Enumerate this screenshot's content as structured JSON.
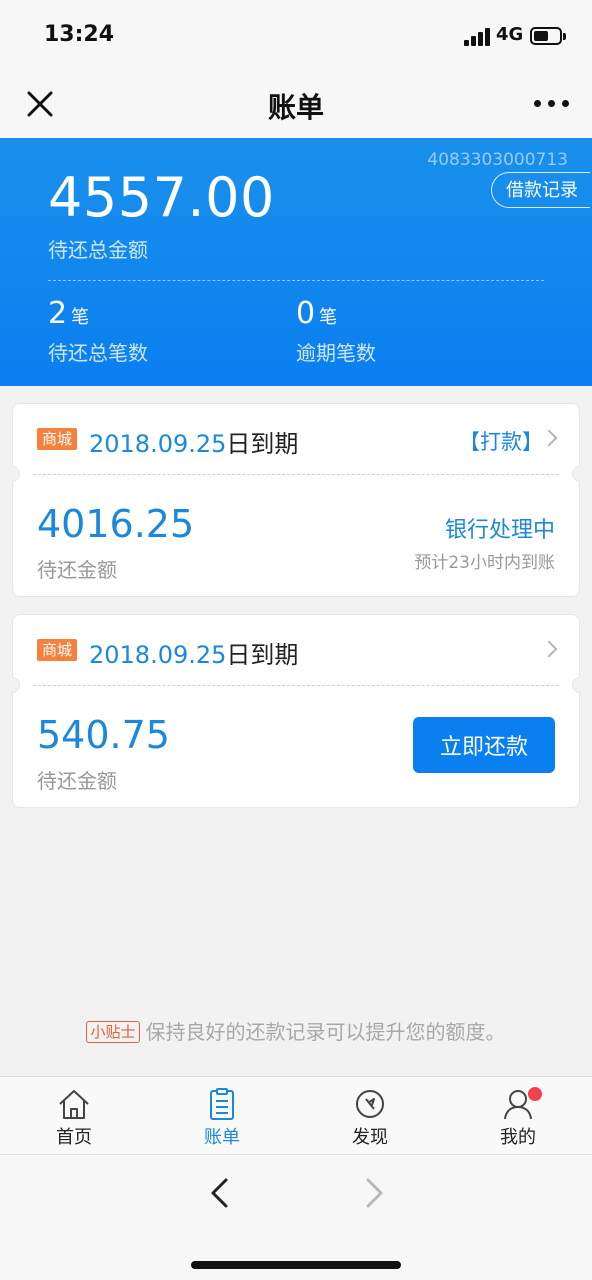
{
  "status_bar": {
    "time": "13:24",
    "network": "4G"
  },
  "nav": {
    "title": "账单"
  },
  "summary": {
    "account_no": "4083303000713",
    "loan_record_label": "借款记录",
    "total_amount": "4557.00",
    "total_label": "待还总金额",
    "pending_count": "2",
    "pending_unit": "笔",
    "pending_label": "待还总笔数",
    "overdue_count": "0",
    "overdue_unit": "笔",
    "overdue_label": "逾期笔数"
  },
  "bills": [
    {
      "tag": "商城",
      "due_date": "2018.09.25",
      "due_suffix": "日到期",
      "action": "【打款】",
      "amount": "4016.25",
      "amount_label": "待还金额",
      "status": "银行处理中",
      "status_note": "预计23小时内到账"
    },
    {
      "tag": "商城",
      "due_date": "2018.09.25",
      "due_suffix": "日到期",
      "amount": "540.75",
      "amount_label": "待还金额",
      "repay_button": "立即还款"
    }
  ],
  "tip": {
    "badge": "小贴士",
    "text": "保持良好的还款记录可以提升您的额度。"
  },
  "tabs": [
    {
      "label": "首页",
      "icon": "home-icon"
    },
    {
      "label": "账单",
      "icon": "bill-icon"
    },
    {
      "label": "发现",
      "icon": "compass-icon"
    },
    {
      "label": "我的",
      "icon": "user-icon"
    }
  ],
  "colors": {
    "primary": "#0a7ff0",
    "accent_text": "#1a88de",
    "mall_tag": "#f5813c",
    "badge_red": "#f2414b"
  }
}
